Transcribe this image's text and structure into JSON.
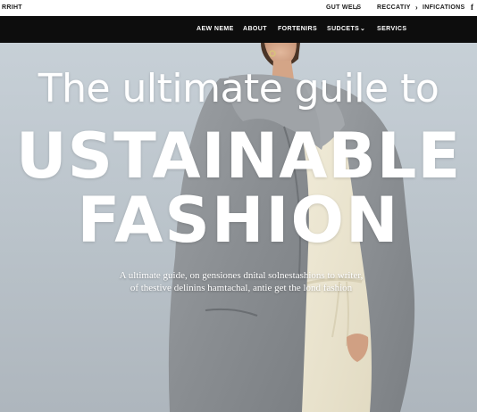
{
  "utility_bar": {
    "brand": "RRIHT",
    "links": [
      {
        "label": "GUT WELS",
        "chevron": "›"
      },
      {
        "label": "RECCATIY",
        "chevron": "›"
      },
      {
        "label": "INFICATIONS"
      }
    ],
    "social_icon": "facebook-icon",
    "social_glyph": "f"
  },
  "nav": {
    "items": [
      "AEW NEME",
      "ABOUT",
      "FORTENIRS",
      "SUDCETS",
      "SERVICS"
    ],
    "dropdown_chevron": "⌄"
  },
  "hero": {
    "title_line1": "The ultimate guile to",
    "title_line2": "USTAINABLE",
    "title_line3": "FASHION",
    "subtitle_line1": "A ultimate guide, on gensiones dnital solnestashions to writer,",
    "subtitle_line2": "of thestive delinins hamtachal, antie get the lond fashion"
  },
  "colors": {
    "nav_background": "#0d0d0d",
    "hero_background": "#c1cad1",
    "coat": "#8e9296",
    "dress": "#ece6d2"
  }
}
